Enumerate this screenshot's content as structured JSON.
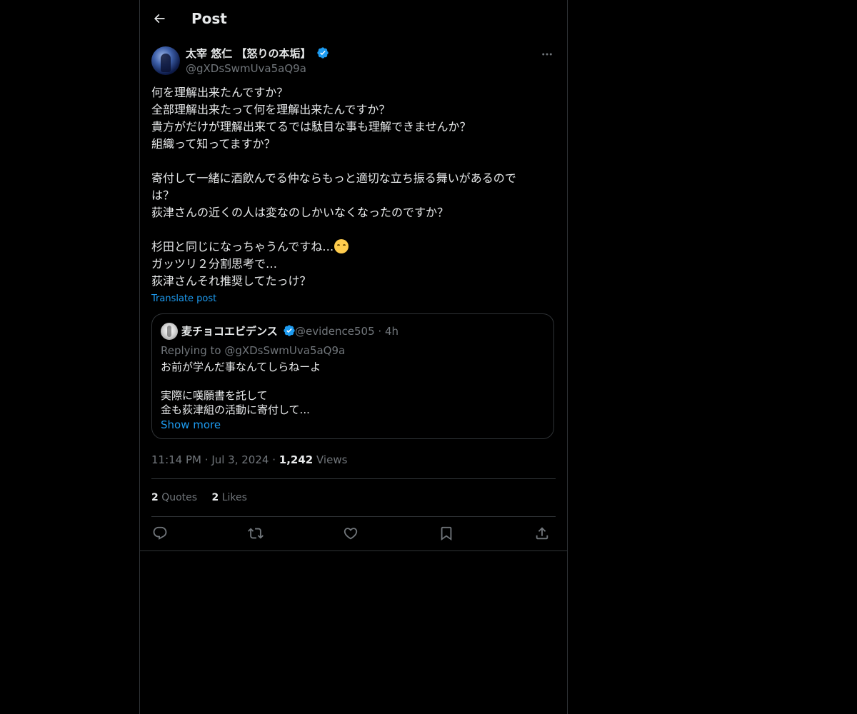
{
  "header": {
    "title": "Post"
  },
  "post": {
    "author_name": "太宰 悠仁 【怒りの本垢】",
    "author_handle": "@gXDsSwmUva5aQ9a",
    "paragraphs": [
      "何を理解出来たんですか？",
      "全部理解出来たって何を理解出来たんですか？",
      "貴方がだけが理解出来てるでは駄目な事も理解できませんか？",
      "組織って知ってますか？",
      "",
      "寄付して一緒に酒飲んでる仲ならもっと適切な立ち振る舞いがあるので",
      "は？",
      "荻津さんの近くの人は変なのしかいなくなったのですか？",
      "",
      "杉田と同じになっちゃうんですね…",
      "ガッツリ２分割思考で…",
      "荻津さんそれ推奨してたっけ？"
    ],
    "translate_label": "Translate post",
    "time": "11:14 PM",
    "date": "Jul 3, 2024",
    "views_count": "1,242",
    "views_label": "Views",
    "quotes_count": "2",
    "quotes_label": "Quotes",
    "likes_count": "2",
    "likes_label": "Likes"
  },
  "quoted": {
    "author_name": "麦チョコエビデンス",
    "author_handle": "@evidence505",
    "age": "4h",
    "replying_to": "Replying to @gXDsSwmUva5aQ9a",
    "lines": [
      "お前が学んだ事なんてしらねーよ",
      "",
      "実際に嘆願書を託して",
      "金も荻津組の活動に寄付して..."
    ],
    "show_more": "Show more"
  },
  "colors": {
    "background": "#000000",
    "text": "#e7e9ea",
    "muted": "#71767b",
    "accent": "#1d9bf0",
    "border": "#2f3336"
  },
  "icons": [
    "back-arrow-icon",
    "verified-badge-icon",
    "more-icon",
    "emoji-icon",
    "reply-icon",
    "repost-icon",
    "like-icon",
    "bookmark-icon",
    "share-icon"
  ]
}
